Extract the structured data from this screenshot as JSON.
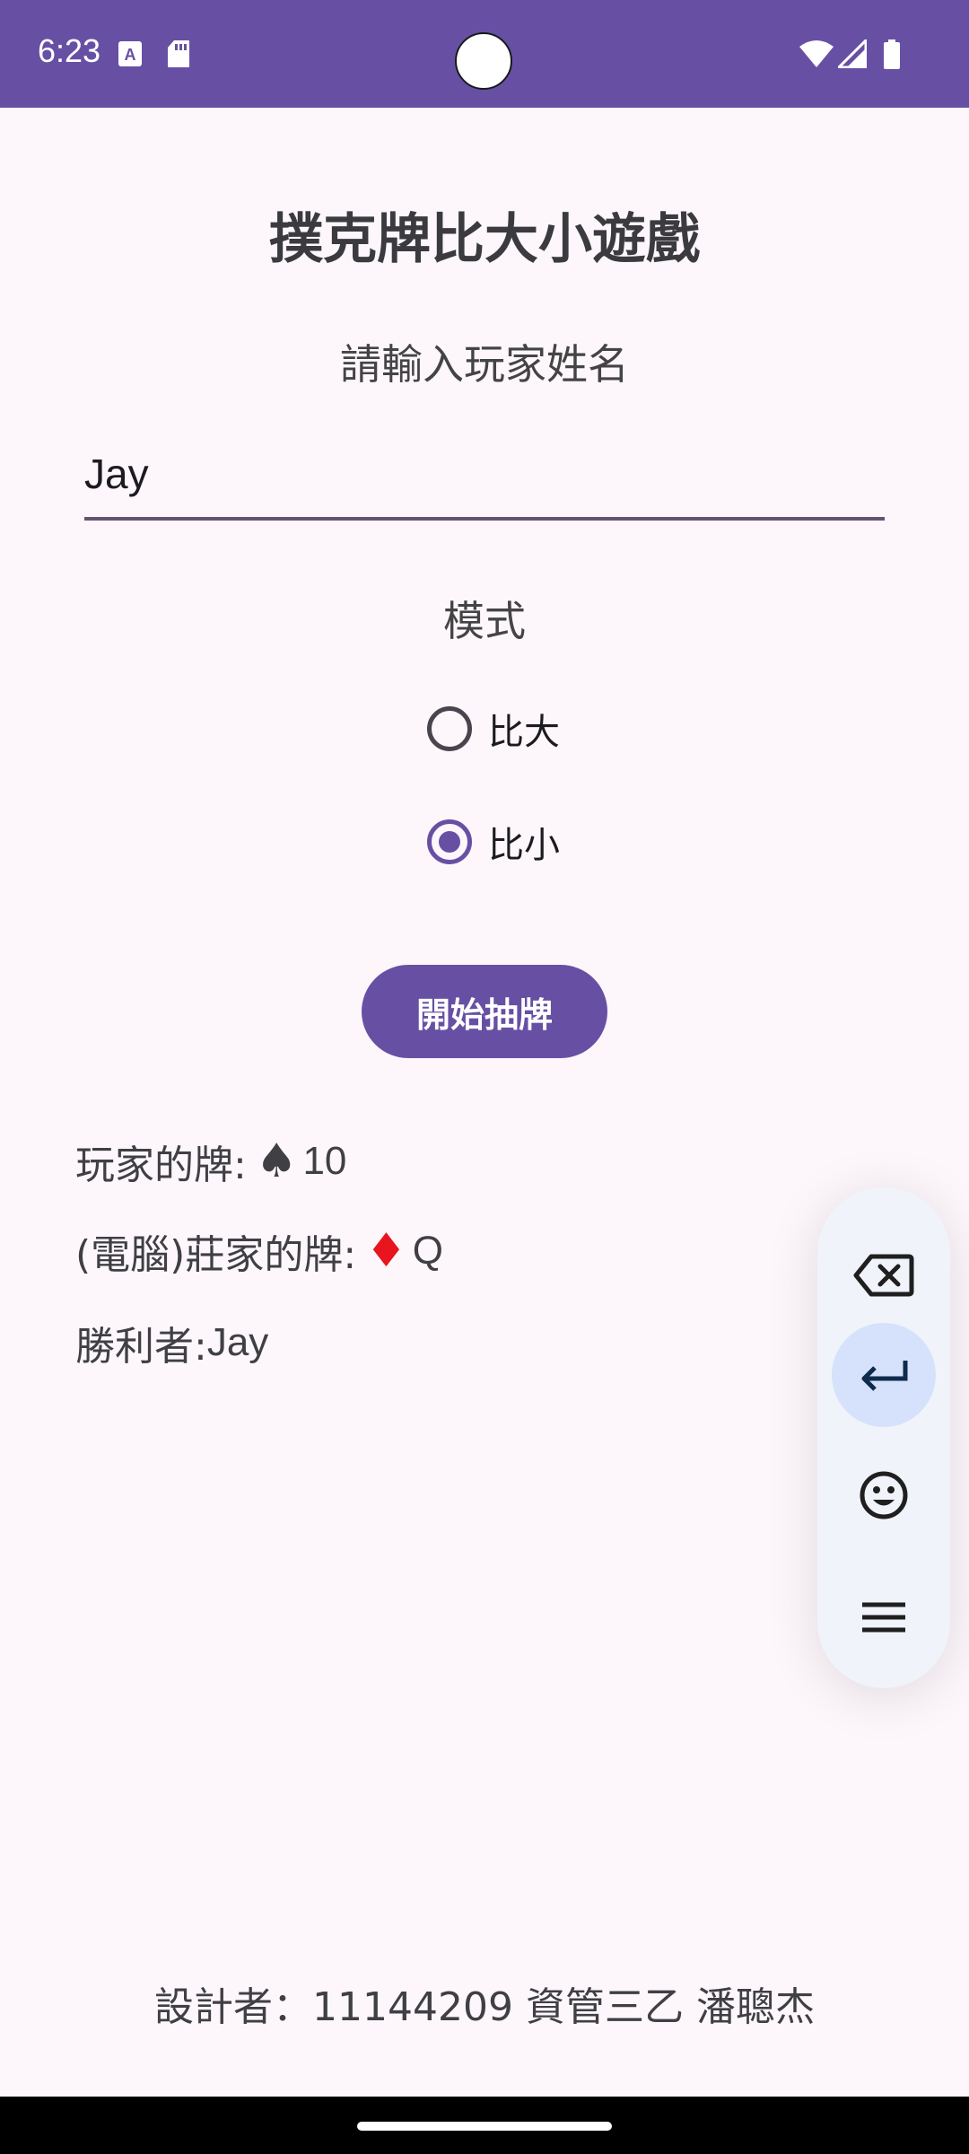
{
  "status_bar": {
    "time": "6:23",
    "icons": [
      "keyboard-a-icon",
      "sd-card-icon",
      "wifi-icon",
      "signal-icon",
      "battery-icon"
    ]
  },
  "app": {
    "title": "撲克牌比大小遊戲",
    "name_prompt": "請輸入玩家姓名",
    "name_value": "Jay",
    "mode_label": "模式",
    "modes": [
      {
        "label": "比大",
        "checked": false
      },
      {
        "label": "比小",
        "checked": true
      }
    ],
    "start_button": "開始抽牌",
    "player_card_label": "玩家的牌: ",
    "player_card_suit": "♠",
    "player_card_value": "10",
    "dealer_card_label": "(電腦)莊家的牌: ",
    "dealer_card_suit": "♦",
    "dealer_card_value": "Q",
    "winner_label": "勝利者: ",
    "winner_value": "Jay",
    "footer": "設計者：11144209 資管三乙 潘聰杰"
  },
  "colors": {
    "primary": "#6750a4",
    "background": "#fdf7fc",
    "spade": "#3f3f44",
    "diamond": "#e8141e"
  },
  "keyboard_toolbar": {
    "items": [
      "backspace-icon",
      "enter-icon",
      "emoji-icon",
      "menu-icon"
    ],
    "active": "enter-icon"
  }
}
